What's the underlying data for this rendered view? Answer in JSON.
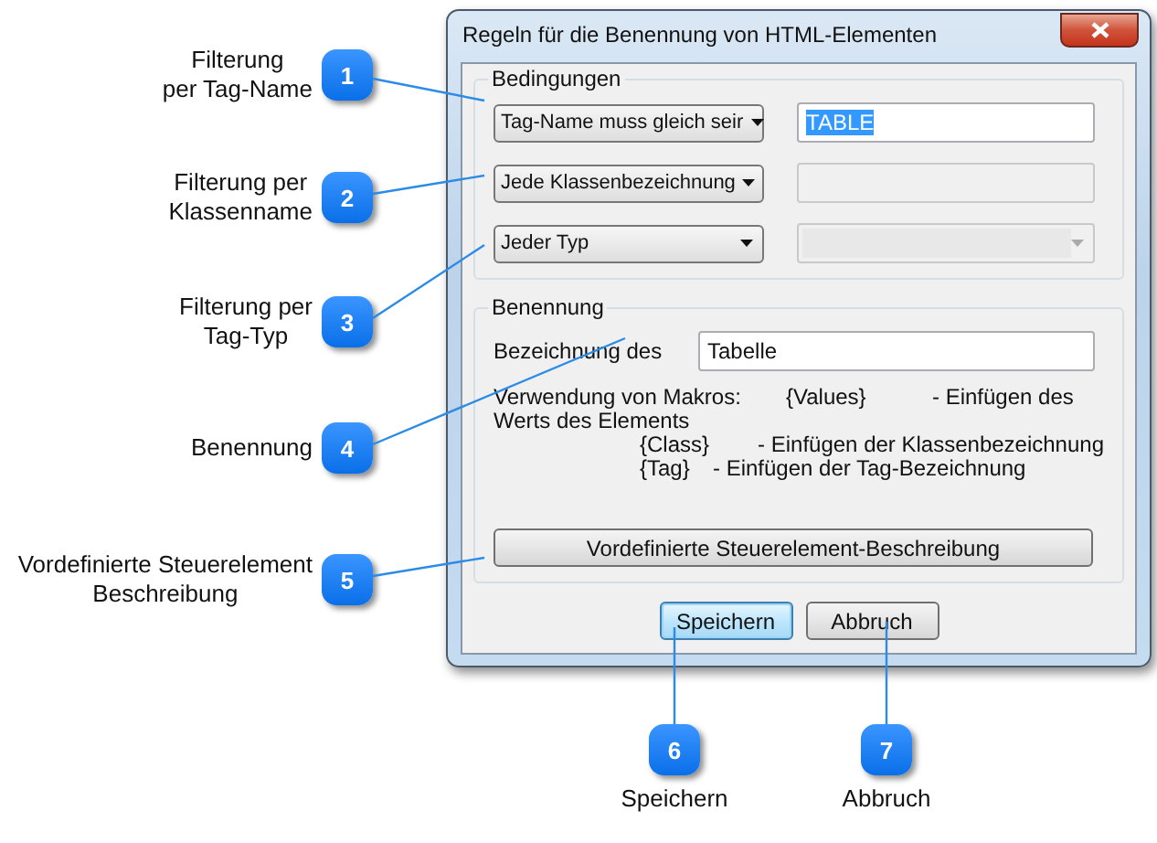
{
  "window": {
    "title": "Regeln für die Benennung von HTML-Elementen"
  },
  "conditions": {
    "title": "Bedingungen",
    "rows": [
      {
        "dropdown": "Tag-Name muss gleich seir",
        "field": {
          "kind": "text",
          "value": "TABLE",
          "selected": true,
          "disabled": false
        }
      },
      {
        "dropdown": "Jede Klassenbezeichnung",
        "field": {
          "kind": "text",
          "disabled": true
        }
      },
      {
        "dropdown": "Jeder Typ",
        "field": {
          "kind": "combo",
          "disabled": true
        }
      }
    ]
  },
  "naming": {
    "title": "Benennung",
    "label": "Bezeichnung des",
    "value": "Tabelle",
    "macro_intro": "Verwendung von Makros:",
    "macros": [
      {
        "macro": "{Values}",
        "description": "- Einfügen des",
        "continued": "Werts des Elements"
      },
      {
        "macro": "{Class}",
        "description": "- Einfügen der Klassenbezeichnung"
      },
      {
        "macro": "{Tag}",
        "description": "- Einfügen der Tag-Bezeichnung"
      }
    ],
    "predefined_button": "Vordefinierte Steuerelement-Beschreibung"
  },
  "buttons": [
    {
      "label": "Speichern",
      "default": true
    },
    {
      "label": "Abbruch",
      "default": false
    }
  ],
  "callouts": [
    {
      "number": "1",
      "label": "Filterung\nper Tag-Name"
    },
    {
      "number": "2",
      "label": "Filterung per\nKlassenname"
    },
    {
      "number": "3",
      "label": "Filterung per\nTag-Typ"
    },
    {
      "number": "4",
      "label": "Benennung"
    },
    {
      "number": "5",
      "label": "Vordefinierte Steuerelement\nBeschreibung"
    },
    {
      "number": "6",
      "label": "Speichern"
    },
    {
      "number": "7",
      "label": "Abbruch"
    }
  ]
}
